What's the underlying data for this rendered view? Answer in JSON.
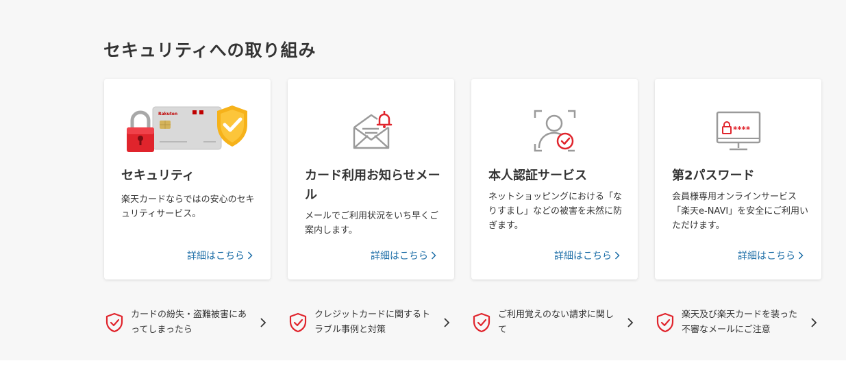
{
  "section": {
    "title": "セキュリティへの取り組み"
  },
  "cards": [
    {
      "title": "セキュリティ",
      "description": "楽天カードならではの安心のセキュリティサービス。",
      "link": "詳細はこちら",
      "icon": "card-lock-shield-illustration",
      "card_brand_text": "Rakuten"
    },
    {
      "title": "カード利用お知らせメール",
      "description": "メールでご利用状況をいち早くご案内します。",
      "link": "詳細はこちら",
      "icon": "mail-bell-icon"
    },
    {
      "title": "本人認証サービス",
      "description": "ネットショッピングにおける「なりすまし」などの被害を未然に防ぎます。",
      "link": "詳細はこちら",
      "icon": "user-verification-icon"
    },
    {
      "title": "第2パスワード",
      "description": "会員様専用オンラインサービス「楽天e-NAVI」を安全にご利用いただけます。",
      "link": "詳細はこちら",
      "icon": "monitor-password-icon",
      "password_mask": "****"
    }
  ],
  "bottom_links": [
    {
      "text": "カードの紛失・盗難被害にあってしまったら",
      "icon": "shield-check-icon"
    },
    {
      "text": "クレジットカードに関するトラブル事例と対策",
      "icon": "shield-check-icon"
    },
    {
      "text": "ご利用覚えのない請求に関して",
      "icon": "shield-check-icon"
    },
    {
      "text": "楽天及び楽天カードを装った不審なメールにご注意",
      "icon": "shield-check-icon"
    }
  ],
  "colors": {
    "accent_red": "#e0242c",
    "link_blue": "#1d6ea7",
    "icon_gray": "#9a9a9a",
    "background": "#f7f7f7"
  }
}
